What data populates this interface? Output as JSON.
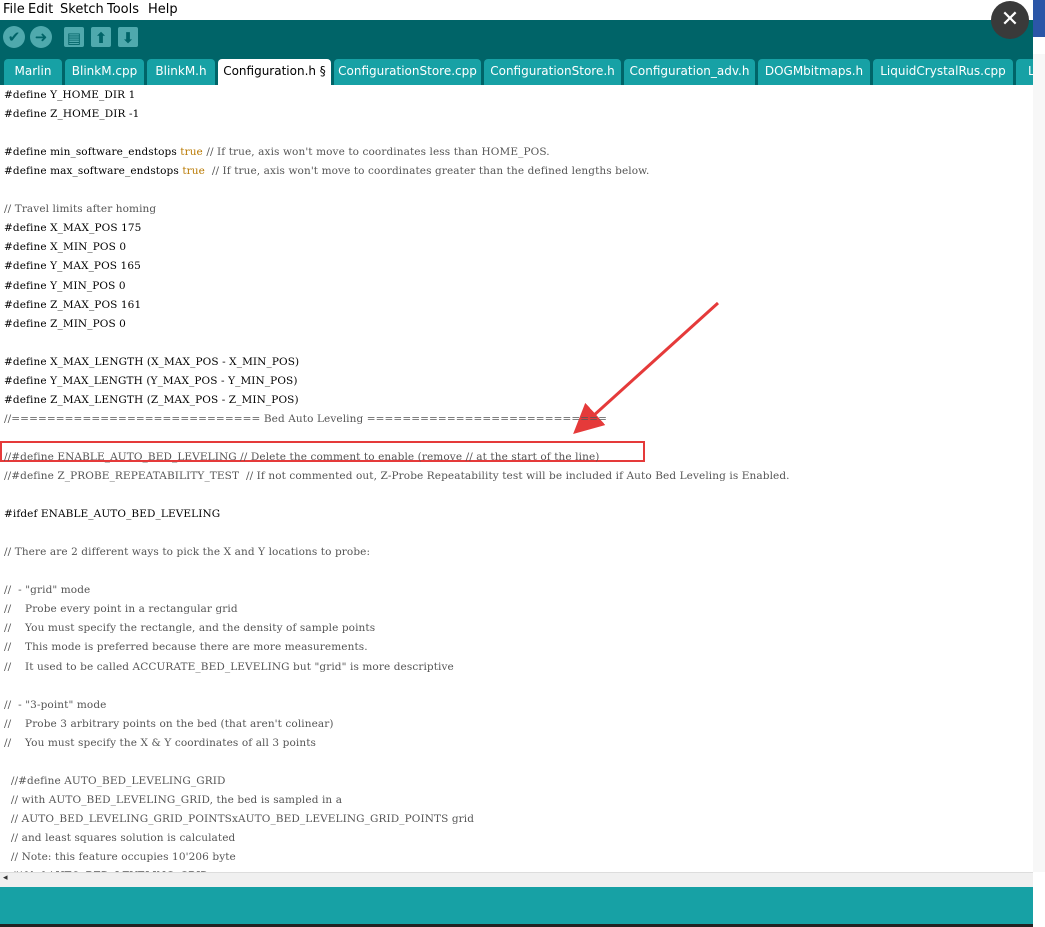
{
  "menu": [
    "File",
    "Edit",
    "Sketch",
    "Tools",
    "Help"
  ],
  "toolbar": {
    "verify_icon": "✔",
    "upload_icon": "➜",
    "new_icon": "▤",
    "open_icon": "⬆",
    "save_icon": "⬇"
  },
  "tabs": [
    {
      "label": "Marlin"
    },
    {
      "label": "BlinkM.cpp"
    },
    {
      "label": "BlinkM.h"
    },
    {
      "label": "Configuration.h §"
    },
    {
      "label": "ConfigurationStore.cpp"
    },
    {
      "label": "ConfigurationStore.h"
    },
    {
      "label": "Configuration_adv.h"
    },
    {
      "label": "DOGMbitmaps.h"
    },
    {
      "label": "LiquidCrystalRus.cpp"
    },
    {
      "label": "L"
    }
  ],
  "close_label": "✕",
  "scroll_left": "◂",
  "colors": {
    "accent": "#006468",
    "tab": "#17a1a5",
    "highlight": "#e53a3a",
    "keyword": "#b87800"
  },
  "code": [
    {
      "pre": "#define Y_HOME_DIR 1"
    },
    {
      "pre": "#define Z_HOME_DIR -1"
    },
    {
      "pre": ""
    },
    {
      "pre": "#define min_software_endstops ",
      "kw": "true",
      "post": " // If true, axis won't move to coordinates less than HOME_POS."
    },
    {
      "pre": "#define max_software_endstops ",
      "kw": "true",
      "post": "  // If true, axis won't move to coordinates greater than the defined lengths below."
    },
    {
      "pre": ""
    },
    {
      "pre": "// Travel limits after homing"
    },
    {
      "pre": "#define X_MAX_POS 175"
    },
    {
      "pre": "#define X_MIN_POS 0"
    },
    {
      "pre": "#define Y_MAX_POS 165"
    },
    {
      "pre": "#define Y_MIN_POS 0"
    },
    {
      "pre": "#define Z_MAX_POS 161"
    },
    {
      "pre": "#define Z_MIN_POS 0"
    },
    {
      "pre": ""
    },
    {
      "pre": "#define X_MAX_LENGTH (X_MAX_POS - X_MIN_POS)"
    },
    {
      "pre": "#define Y_MAX_LENGTH (Y_MAX_POS - Y_MIN_POS)"
    },
    {
      "pre": "#define Z_MAX_LENGTH (Z_MAX_POS - Z_MIN_POS)"
    },
    {
      "pre": "//============================ Bed Auto Leveling ==========================="
    },
    {
      "pre": ""
    },
    {
      "pre": "//#define ENABLE_AUTO_BED_LEVELING // Delete the comment to enable (remove // at the start of the line)"
    },
    {
      "pre": "//#define Z_PROBE_REPEATABILITY_TEST  // If not commented out, Z-Probe Repeatability test will be included if Auto Bed Leveling is Enabled."
    },
    {
      "pre": ""
    },
    {
      "pre": "#ifdef ENABLE_AUTO_BED_LEVELING"
    },
    {
      "pre": ""
    },
    {
      "pre": "// There are 2 different ways to pick the X and Y locations to probe:"
    },
    {
      "pre": ""
    },
    {
      "pre": "//  - \"grid\" mode"
    },
    {
      "pre": "//    Probe every point in a rectangular grid"
    },
    {
      "pre": "//    You must specify the rectangle, and the density of sample points"
    },
    {
      "pre": "//    This mode is preferred because there are more measurements."
    },
    {
      "pre": "//    It used to be called ACCURATE_BED_LEVELING but \"grid\" is more descriptive"
    },
    {
      "pre": ""
    },
    {
      "pre": "//  - \"3-point\" mode"
    },
    {
      "pre": "//    Probe 3 arbitrary points on the bed (that aren't colinear)"
    },
    {
      "pre": "//    You must specify the X & Y coordinates of all 3 points"
    },
    {
      "pre": ""
    },
    {
      "pre": "  //#define AUTO_BED_LEVELING_GRID"
    },
    {
      "pre": "  // with AUTO_BED_LEVELING_GRID, the bed is sampled in a"
    },
    {
      "pre": "  // AUTO_BED_LEVELING_GRID_POINTSxAUTO_BED_LEVELING_GRID_POINTS grid"
    },
    {
      "pre": "  // and least squares solution is calculated"
    },
    {
      "pre": "  // Note: this feature occupies 10'206 byte"
    },
    {
      "pre": "  #ifdef AUTO_BED_LEVELING_GRID"
    }
  ]
}
